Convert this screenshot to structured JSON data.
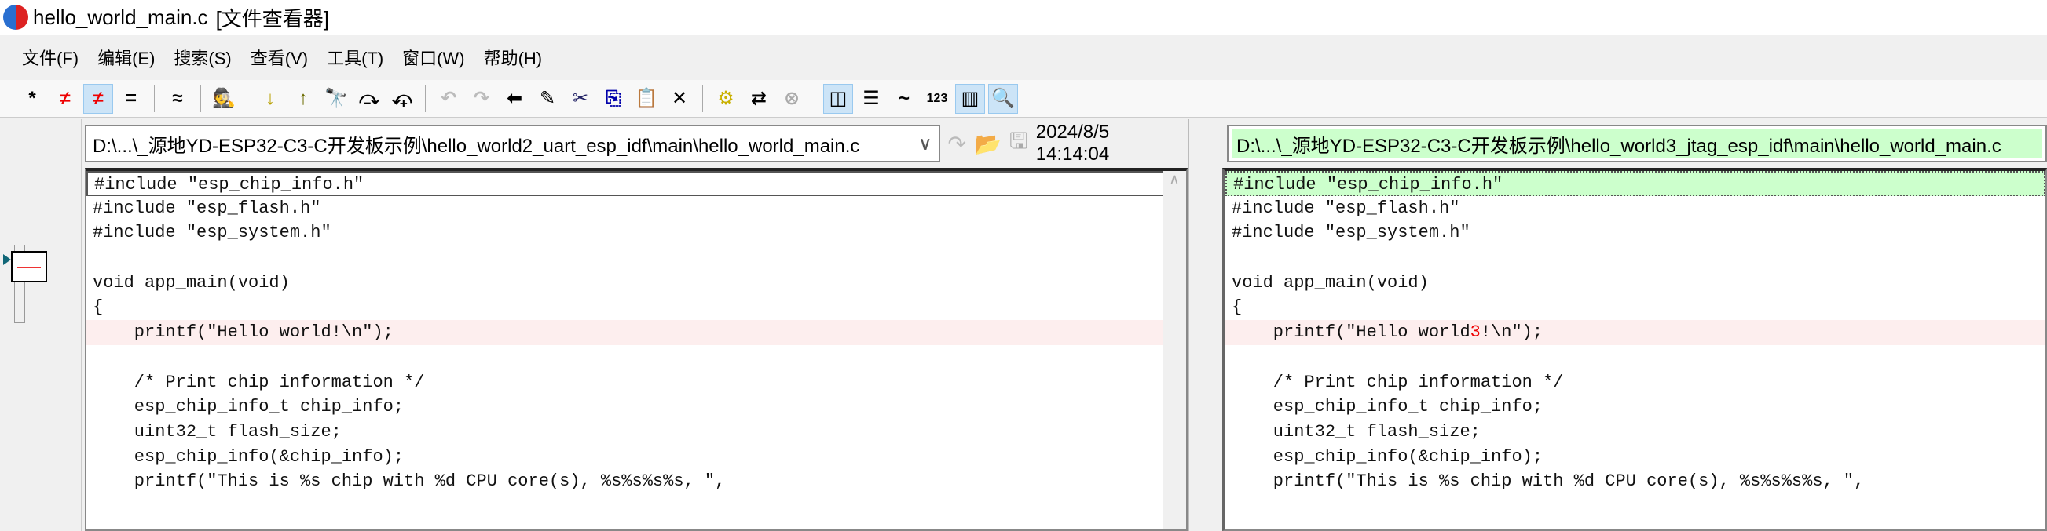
{
  "title": {
    "filename": "hello_world_main.c",
    "app": "[文件查看器]"
  },
  "menu": [
    "文件(F)",
    "编辑(E)",
    "搜索(S)",
    "查看(V)",
    "工具(T)",
    "窗口(W)",
    "帮助(H)"
  ],
  "toolbar": [
    {
      "icon": "all-lines-icon",
      "glyph": "*"
    },
    {
      "icon": "diff-lines-icon",
      "glyph": "≠",
      "color": "#e00"
    },
    {
      "icon": "diff-context-icon",
      "glyph": "≠",
      "color": "#e00",
      "active": true
    },
    {
      "icon": "same-lines-icon",
      "glyph": "="
    },
    {
      "sep": true
    },
    {
      "icon": "similar-icon",
      "glyph": "≈"
    },
    {
      "sep": true
    },
    {
      "icon": "wizard-icon",
      "glyph": "🕵"
    },
    {
      "sep": true
    },
    {
      "icon": "next-diff-icon",
      "glyph": "↓",
      "color": "#b8a000"
    },
    {
      "icon": "prev-diff-icon",
      "glyph": "↑",
      "color": "#6b6b00"
    },
    {
      "icon": "find-icon",
      "glyph": "🔭"
    },
    {
      "icon": "find-next-icon",
      "glyph": "⤼"
    },
    {
      "icon": "find-prev-icon",
      "glyph": "⤽"
    },
    {
      "sep": true
    },
    {
      "icon": "undo-icon",
      "glyph": "↶",
      "color": "#bbb"
    },
    {
      "icon": "redo-icon",
      "glyph": "↷",
      "color": "#bbb"
    },
    {
      "icon": "copy-to-left-icon",
      "glyph": "⬅"
    },
    {
      "icon": "edit-icon",
      "glyph": "✎"
    },
    {
      "icon": "cut-icon",
      "glyph": "✂",
      "color": "#226"
    },
    {
      "icon": "copy-icon",
      "glyph": "⎘",
      "color": "#00a"
    },
    {
      "icon": "paste-icon",
      "glyph": "📋"
    },
    {
      "icon": "delete-icon",
      "glyph": "✕"
    },
    {
      "sep": true
    },
    {
      "icon": "sync-icon",
      "glyph": "⚙",
      "color": "#c9b000"
    },
    {
      "icon": "swap-icon",
      "glyph": "⇄"
    },
    {
      "icon": "cancel-icon",
      "glyph": "⊗",
      "color": "#aaa"
    },
    {
      "sep": true
    },
    {
      "icon": "side-by-side-icon",
      "glyph": "◫",
      "active": true
    },
    {
      "icon": "over-under-icon",
      "glyph": "☰"
    },
    {
      "icon": "ignore-whitespace-icon",
      "glyph": "~"
    },
    {
      "icon": "line-numbers-icon",
      "glyph": "123"
    },
    {
      "icon": "thumbnail-icon",
      "glyph": "▥",
      "active": true
    },
    {
      "icon": "zoom-icon",
      "glyph": "🔍",
      "active": true
    }
  ],
  "left": {
    "path": "D:\\...\\_源地YD-ESP32-C3-C开发板示例\\hello_world2_uart_esp_idf\\main\\hello_world_main.c",
    "dropdown": "∨",
    "timestamp": "2024/8/5 14:14:04",
    "lines": [
      "#include \"esp_chip_info.h\"",
      "#include \"esp_flash.h\"",
      "#include \"esp_system.h\"",
      "",
      "void app_main(void)",
      "{",
      "    printf(\"Hello world!\\n\");",
      "",
      "    /* Print chip information */",
      "    esp_chip_info_t chip_info;",
      "    uint32_t flash_size;",
      "    esp_chip_info(&chip_info);",
      "    printf(\"This is %s chip with %d CPU core(s), %s%s%s%s, \","
    ]
  },
  "right": {
    "path": "D:\\...\\_源地YD-ESP32-C3-C开发板示例\\hello_world3_jtag_esp_idf\\main\\hello_world_main.c",
    "lines": [
      "#include \"esp_chip_info.h\"",
      "#include \"esp_flash.h\"",
      "#include \"esp_system.h\"",
      "",
      "void app_main(void)",
      "{",
      "    printf(\"Hello world3!\\n\");",
      "",
      "    /* Print chip information */",
      "    esp_chip_info_t chip_info;",
      "    uint32_t flash_size;",
      "    esp_chip_info(&chip_info);",
      "    printf(\"This is %s chip with %d CPU core(s), %s%s%s%s, \","
    ],
    "diff_line": 6,
    "diff_pre": "    printf(\"Hello world",
    "diff_char": "3",
    "diff_post": "!\\n\");"
  },
  "colors": {
    "diff_bg": "#fdeeee",
    "current_right_bg": "#ccffcc",
    "path_right_bg": "#ccffcc",
    "diff_char": "#e00000"
  }
}
